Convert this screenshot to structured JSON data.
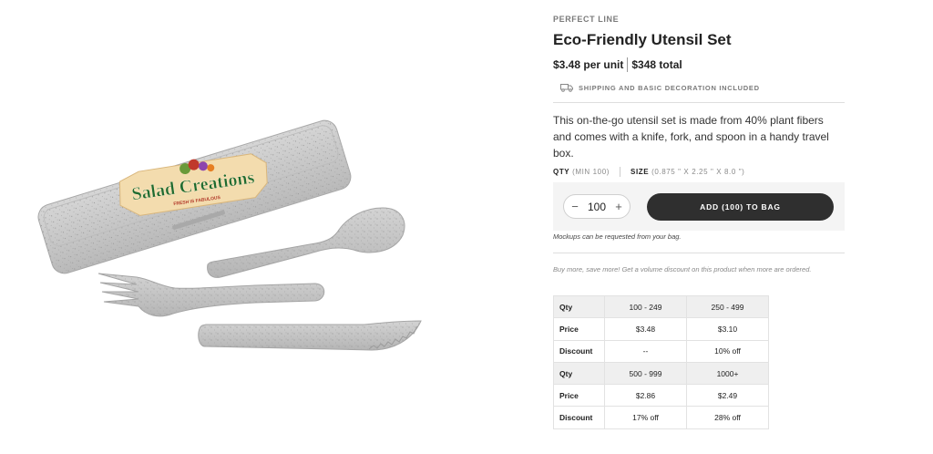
{
  "product": {
    "brand": "PERFECT LINE",
    "title": "Eco-Friendly Utensil Set",
    "unit_price": "$3.48 per unit",
    "total_price": "$348 total",
    "shipping_note": "SHIPPING AND BASIC DECORATION INCLUDED",
    "description": "This on-the-go utensil set is made from 40% plant fibers and comes with a knife, fork, and spoon in a handy travel box.",
    "image_logo": {
      "name": "Salad Creations",
      "tagline": "FRESH IS FABULOUS"
    }
  },
  "specs": {
    "qty_label": "QTY",
    "qty_min": "(MIN 100)",
    "size_label": "SIZE",
    "size_value": "(0.875 \" X 2.25 \" X 8.0 \")"
  },
  "buy": {
    "minus": "−",
    "quantity": "100",
    "plus": "+",
    "add_label": "ADD (100) TO BAG",
    "mockup_note": "Mockups can be requested from your bag."
  },
  "volume": {
    "note": "Buy more, save more! Get a volume discount on this product when more are ordered.",
    "rows": [
      {
        "label": "Qty",
        "values": [
          "100 - 249",
          "250 - 499"
        ],
        "shaded": true
      },
      {
        "label": "Price",
        "values": [
          "$3.48",
          "$3.10"
        ],
        "shaded": false
      },
      {
        "label": "Discount",
        "values": [
          "--",
          "10% off"
        ],
        "shaded": false
      },
      {
        "label": "Qty",
        "values": [
          "500 - 999",
          "1000+"
        ],
        "shaded": true
      },
      {
        "label": "Price",
        "values": [
          "$2.86",
          "$2.49"
        ],
        "shaded": false
      },
      {
        "label": "Discount",
        "values": [
          "17% off",
          "28% off"
        ],
        "shaded": false
      }
    ]
  },
  "icons": {
    "shipping": "truck-icon"
  },
  "colors": {
    "button_bg": "#2f2f2f",
    "table_header_bg": "#efefef",
    "utensil_gray": "#c9c9c9"
  }
}
